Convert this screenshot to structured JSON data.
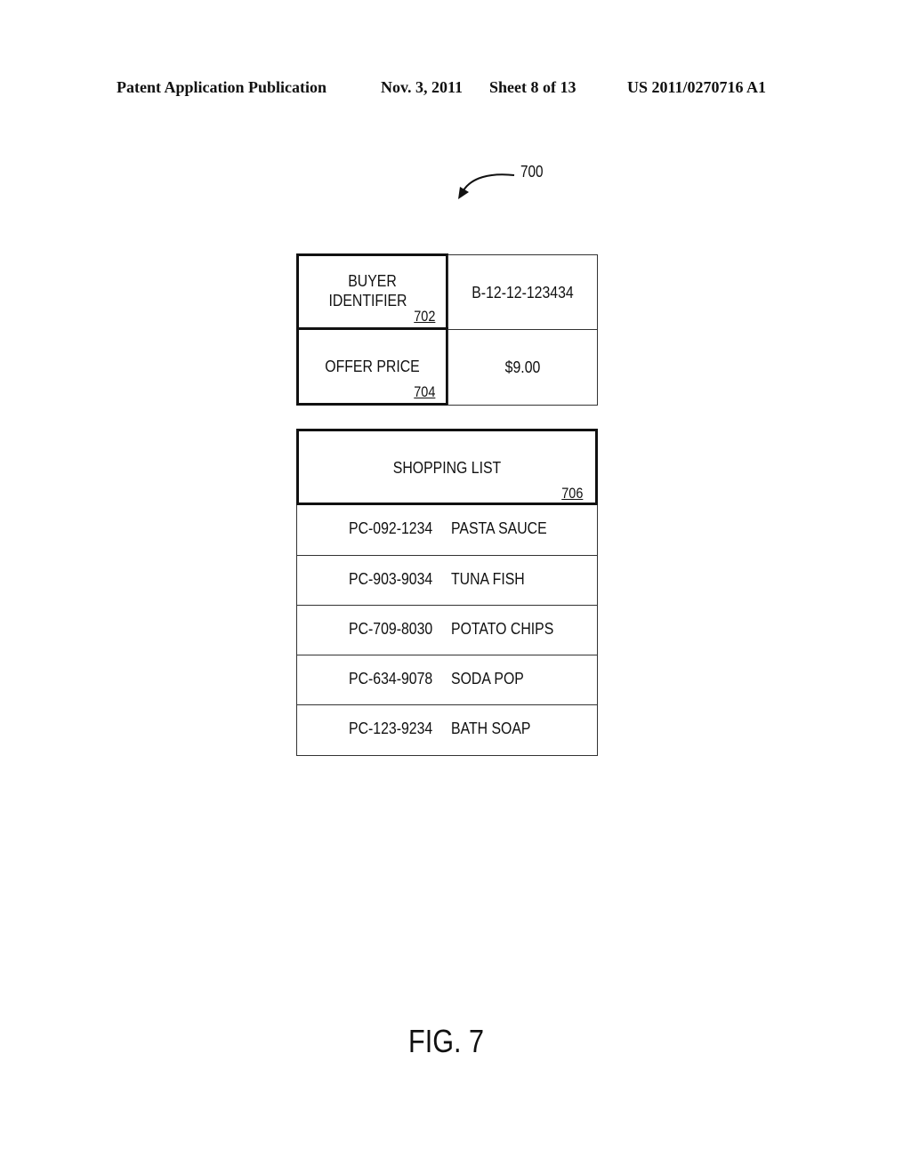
{
  "header": {
    "publication": "Patent Application Publication",
    "date": "Nov. 3, 2011",
    "sheet": "Sheet 8 of 13",
    "number": "US 2011/0270716 A1"
  },
  "figure_ref": {
    "label": "700",
    "icon": "curved-arrow-icon"
  },
  "record": [
    {
      "label_lines": [
        "BUYER",
        "IDENTIFIER"
      ],
      "ref": "702",
      "value": "B-12-12-123434"
    },
    {
      "label_lines": [
        "OFFER PRICE"
      ],
      "ref": "704",
      "value": "$9.00"
    }
  ],
  "shopping_list": {
    "title": "SHOPPING LIST",
    "ref": "706",
    "items": [
      {
        "code": "PC-092-1234",
        "name": "PASTA SAUCE"
      },
      {
        "code": "PC-903-9034",
        "name": "TUNA FISH"
      },
      {
        "code": "PC-709-8030",
        "name": "POTATO CHIPS"
      },
      {
        "code": "PC-634-9078",
        "name": "SODA POP"
      },
      {
        "code": "PC-123-9234",
        "name": "BATH SOAP"
      }
    ]
  },
  "figure_caption": "FIG. 7"
}
